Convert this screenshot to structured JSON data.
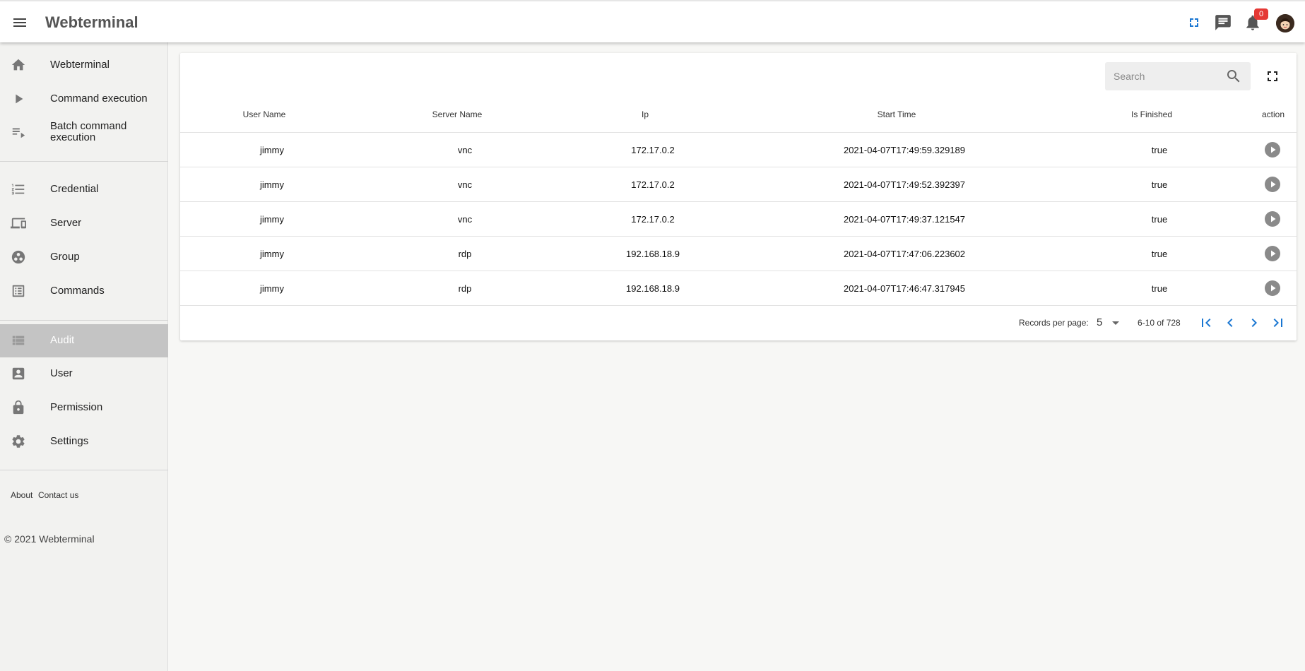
{
  "app": {
    "title": "Webterminal"
  },
  "header": {
    "notification_count": "0"
  },
  "sidebar": {
    "items": [
      {
        "label": "Webterminal",
        "icon": "home-icon"
      },
      {
        "label": "Command execution",
        "icon": "play-arrow-icon"
      },
      {
        "label": "Batch command execution",
        "icon": "playlist-play-icon"
      },
      {
        "label": "Credential",
        "icon": "format-list-numbered-icon"
      },
      {
        "label": "Server",
        "icon": "devices-icon"
      },
      {
        "label": "Group",
        "icon": "group-work-icon"
      },
      {
        "label": "Commands",
        "icon": "list-alt-icon"
      },
      {
        "label": "Audit",
        "icon": "view-list-icon",
        "active": true
      },
      {
        "label": "User",
        "icon": "account-box-icon"
      },
      {
        "label": "Permission",
        "icon": "lock-icon"
      },
      {
        "label": "Settings",
        "icon": "settings-icon"
      }
    ],
    "footer_links": [
      "About",
      "Contact us"
    ],
    "copyright": "© 2021 Webterminal"
  },
  "table": {
    "search_placeholder": "Search",
    "columns": [
      "User Name",
      "Server Name",
      "Ip",
      "Start Time",
      "Is Finished",
      "action"
    ],
    "rows": [
      [
        "jimmy",
        "vnc",
        "172.17.0.2",
        "2021-04-07T17:49:59.329189",
        "true"
      ],
      [
        "jimmy",
        "vnc",
        "172.17.0.2",
        "2021-04-07T17:49:52.392397",
        "true"
      ],
      [
        "jimmy",
        "vnc",
        "172.17.0.2",
        "2021-04-07T17:49:37.121547",
        "true"
      ],
      [
        "jimmy",
        "rdp",
        "192.168.18.9",
        "2021-04-07T17:47:06.223602",
        "true"
      ],
      [
        "jimmy",
        "rdp",
        "192.168.18.9",
        "2021-04-07T17:46:47.317945",
        "true"
      ]
    ],
    "row_action_icon": "play-circle-icon"
  },
  "pagination": {
    "records_per_page_label": "Records per page:",
    "records_per_page": "5",
    "range": "6-10 of 728"
  },
  "colors": {
    "accent": "#1976d2",
    "badge": "#e53935",
    "active_nav": "#c4c4c4"
  }
}
